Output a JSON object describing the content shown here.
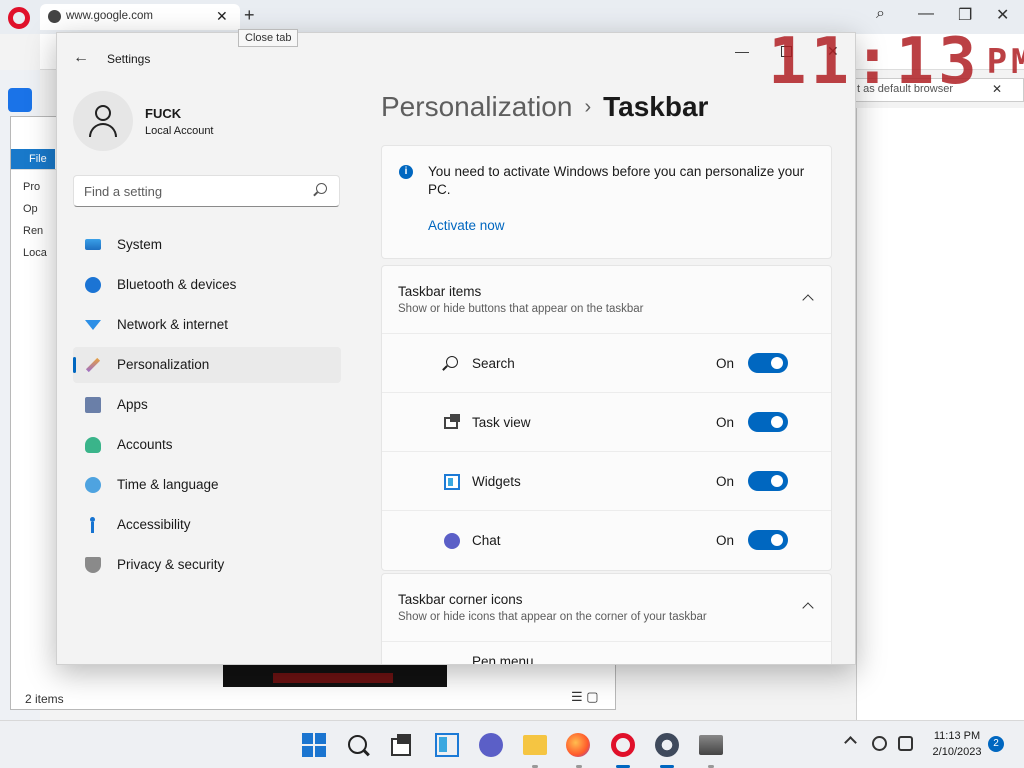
{
  "browser": {
    "tab_title": "www.google.com",
    "tooltip": "Close tab",
    "infobar_text": "t as default browser"
  },
  "explorer": {
    "file_tab": "File",
    "items": [
      "Pro",
      "Op",
      "Ren",
      "Loca"
    ],
    "status": "2 items"
  },
  "overlay_clock": {
    "digits": "11:13",
    "suffix": "PM"
  },
  "settings": {
    "app_title": "Settings",
    "user": {
      "name": "FUCK",
      "type": "Local Account"
    },
    "search": {
      "placeholder": "Find a setting"
    },
    "nav": [
      {
        "label": "System",
        "icon": "system-icon"
      },
      {
        "label": "Bluetooth & devices",
        "icon": "bluetooth-icon"
      },
      {
        "label": "Network & internet",
        "icon": "wifi-icon"
      },
      {
        "label": "Personalization",
        "icon": "brush-icon",
        "active": true
      },
      {
        "label": "Apps",
        "icon": "apps-icon"
      },
      {
        "label": "Accounts",
        "icon": "person-icon"
      },
      {
        "label": "Time & language",
        "icon": "globe-clock-icon"
      },
      {
        "label": "Accessibility",
        "icon": "accessibility-icon"
      },
      {
        "label": "Privacy & security",
        "icon": "shield-icon"
      }
    ],
    "breadcrumb": {
      "parent": "Personalization",
      "separator": "›",
      "current": "Taskbar"
    },
    "notice": {
      "text": "You need to activate Windows before you can personalize your PC.",
      "link": "Activate now"
    },
    "taskbar_items": {
      "title": "Taskbar items",
      "subtitle": "Show or hide buttons that appear on the taskbar",
      "rows": [
        {
          "label": "Search",
          "state": "On",
          "icon": "search-icon"
        },
        {
          "label": "Task view",
          "state": "On",
          "icon": "task-view-icon"
        },
        {
          "label": "Widgets",
          "state": "On",
          "icon": "widgets-icon"
        },
        {
          "label": "Chat",
          "state": "On",
          "icon": "chat-icon"
        }
      ]
    },
    "corner_icons": {
      "title": "Taskbar corner icons",
      "subtitle": "Show or hide icons that appear on the corner of your taskbar",
      "first_row": "Pen menu"
    },
    "accent_color": "#0067c0"
  },
  "taskbar": {
    "time": "11:13 PM",
    "date": "2/10/2023",
    "notifications": "2",
    "icons": [
      "start-icon",
      "search-icon",
      "task-view-icon",
      "widgets-icon",
      "chat-icon",
      "file-explorer-icon",
      "firefox-icon",
      "opera-icon",
      "settings-icon",
      "app-icon"
    ]
  }
}
